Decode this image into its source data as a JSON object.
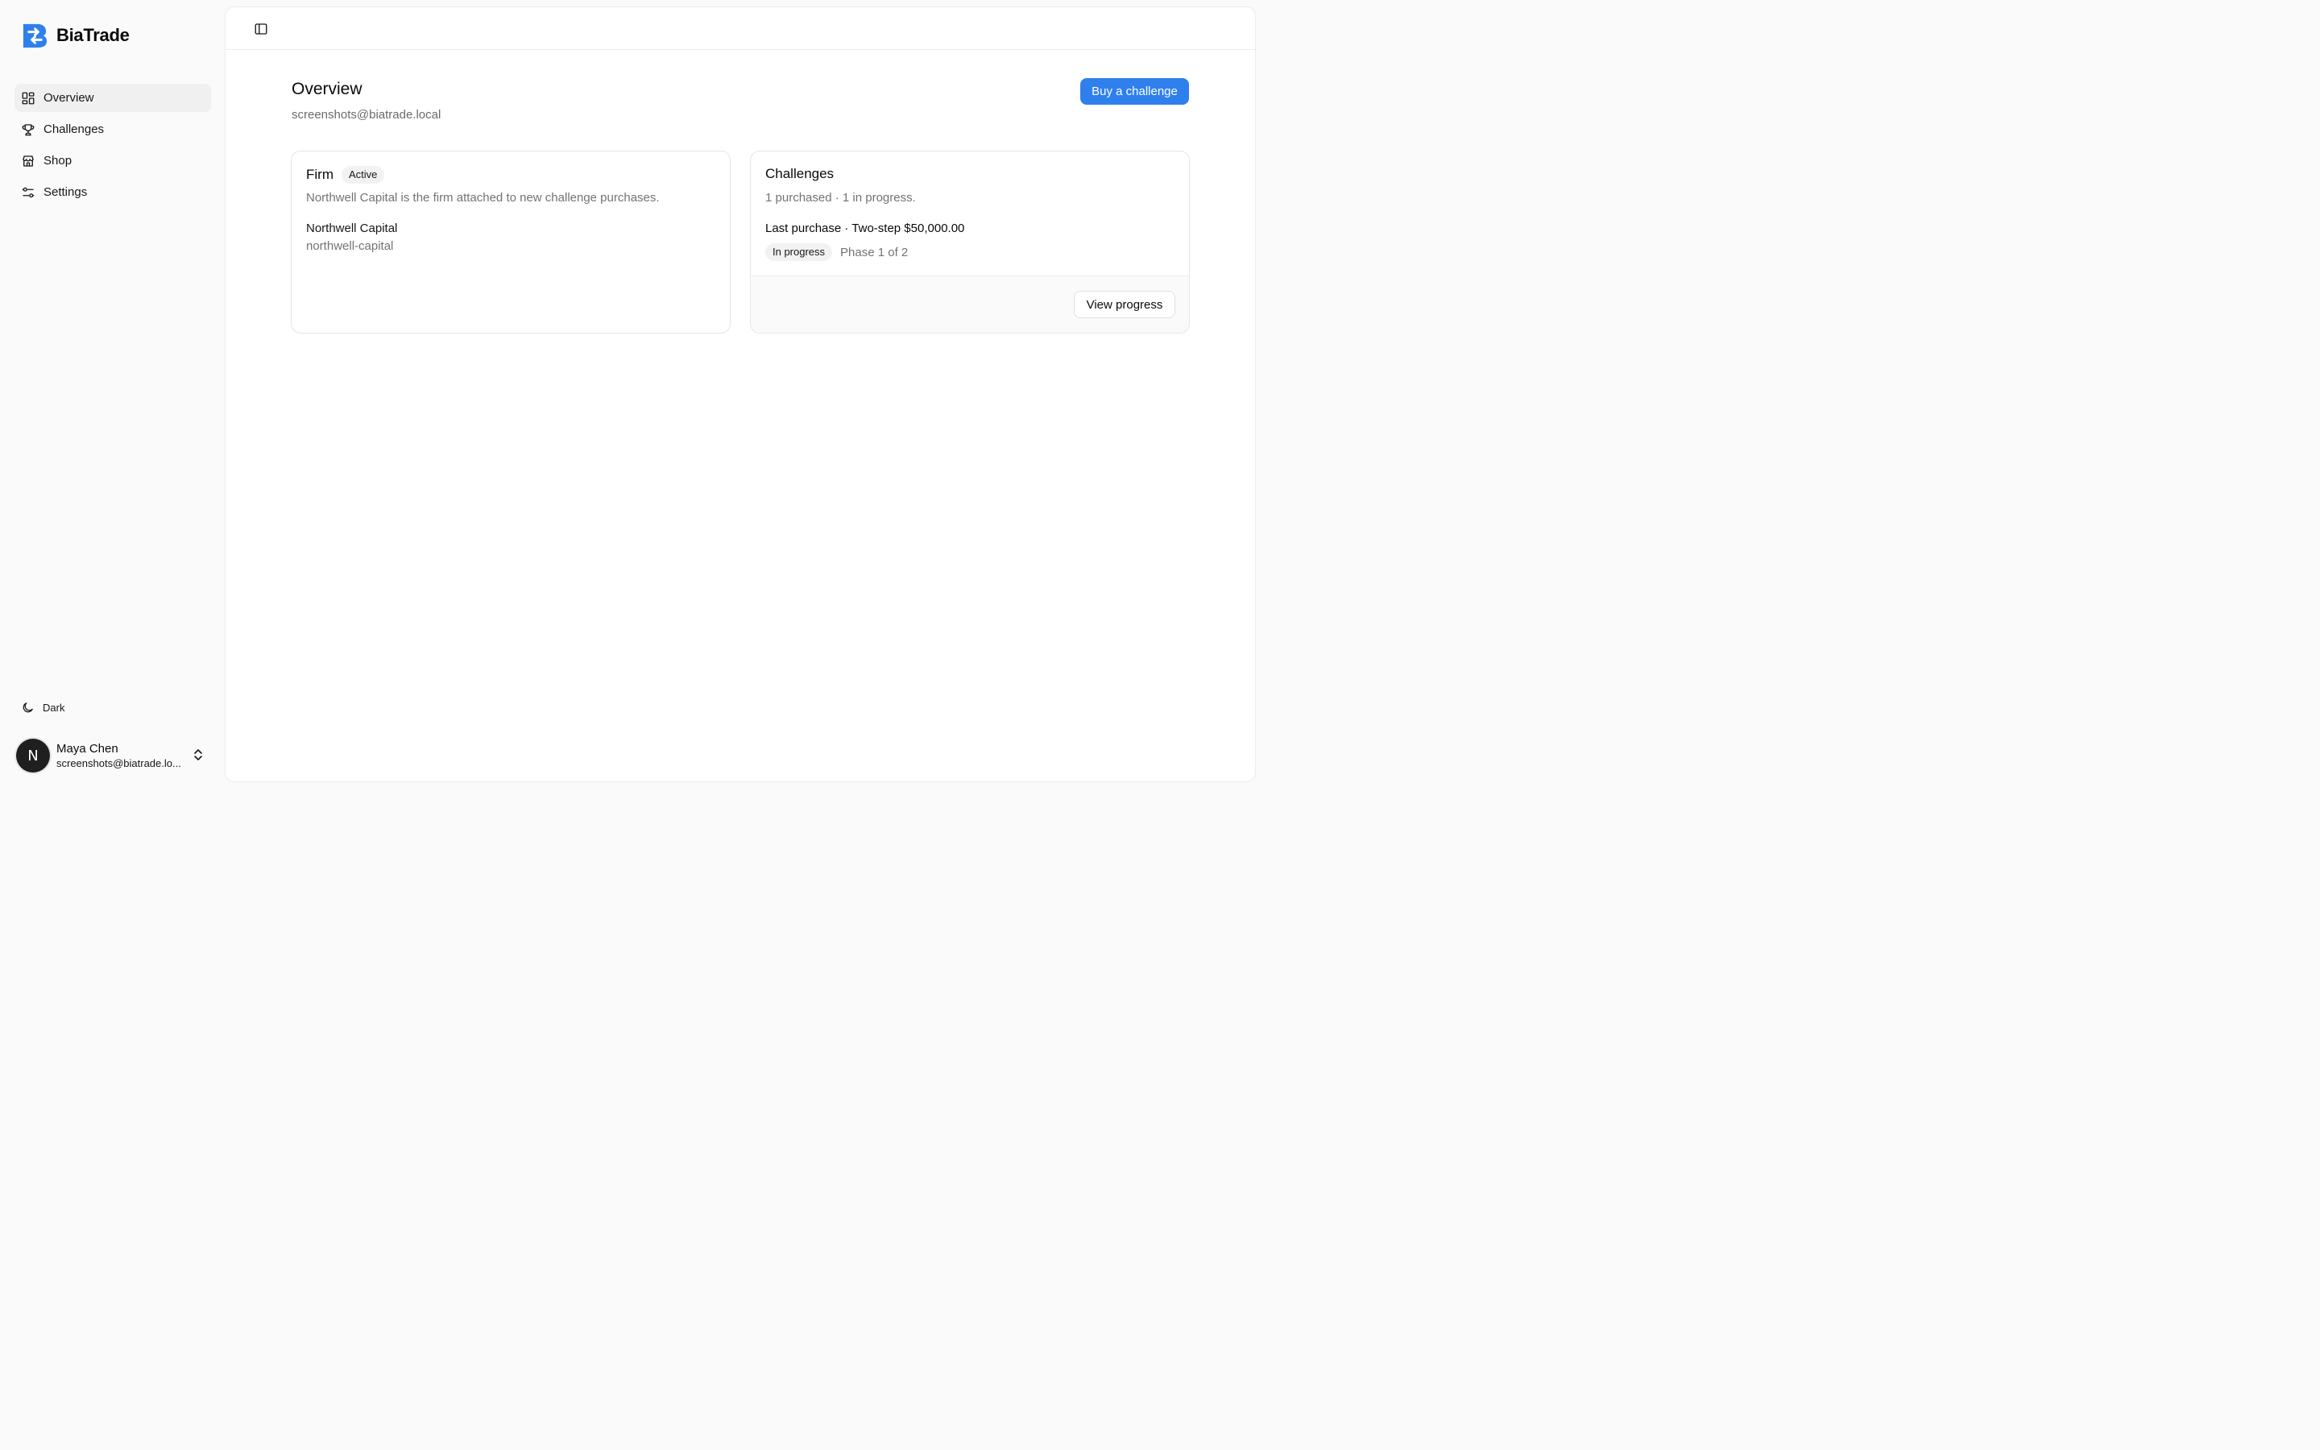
{
  "app": {
    "name": "BiaTrade",
    "brand_color": "#2f80ed"
  },
  "sidebar": {
    "items": [
      {
        "label": "Overview",
        "icon": "dashboard-icon",
        "active": true
      },
      {
        "label": "Challenges",
        "icon": "trophy-icon",
        "active": false
      },
      {
        "label": "Shop",
        "icon": "store-icon",
        "active": false
      },
      {
        "label": "Settings",
        "icon": "sliders-icon",
        "active": false
      }
    ],
    "theme_toggle": {
      "label": "Dark",
      "icon": "moon-icon"
    },
    "user": {
      "initial": "N",
      "name": "Maya Chen",
      "email": "screenshots@biatrade.lo..."
    }
  },
  "header": {
    "toggle_icon": "sidebar-toggle-icon"
  },
  "page": {
    "title": "Overview",
    "subtitle": "screenshots@biatrade.local",
    "buy_button": "Buy a challenge"
  },
  "firm_card": {
    "title": "Firm",
    "badge": "Active",
    "description": "Northwell Capital is the firm attached to new challenge purchases.",
    "firm_name": "Northwell Capital",
    "firm_slug": "northwell-capital"
  },
  "challenges_card": {
    "title": "Challenges",
    "summary": "1 purchased · 1 in progress.",
    "last_purchase": "Last purchase · Two-step $50,000.00",
    "status_badge": "In progress",
    "phase": "Phase 1 of 2",
    "view_button": "View progress"
  }
}
